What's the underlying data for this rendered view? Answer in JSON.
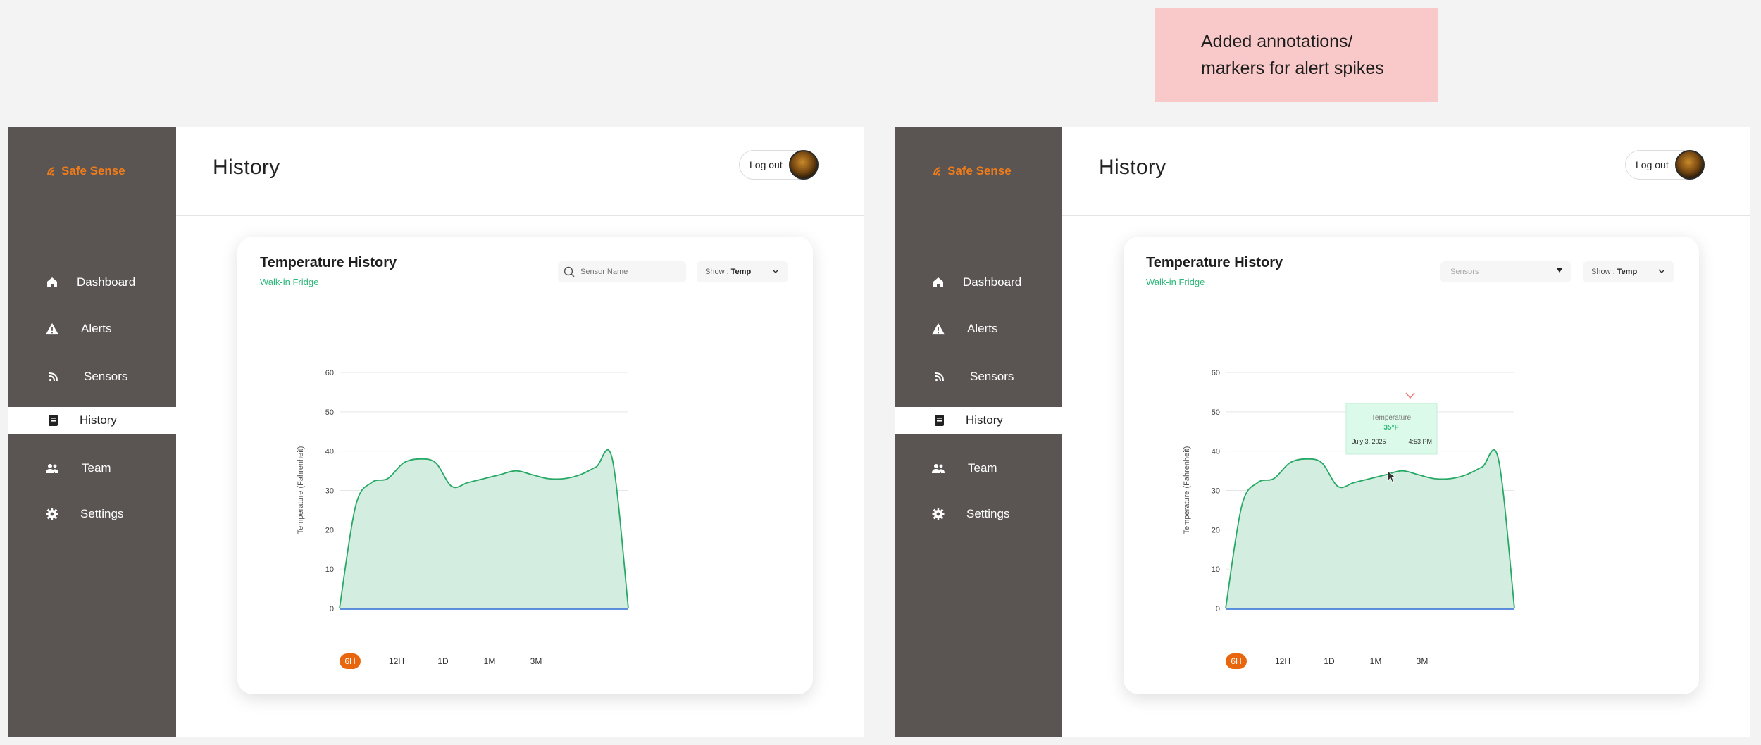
{
  "app": {
    "brand": "Safe Sense"
  },
  "colors": {
    "brand": "#f07c1a",
    "sidebar": "#5a5553",
    "accent_green": "#2fb67a",
    "area_fill": "#d3eee0",
    "area_line": "#28a866",
    "active_range": "#e8670e"
  },
  "nav": [
    {
      "label": "Dashboard",
      "icon": "home-icon"
    },
    {
      "label": "Alerts",
      "icon": "warning-icon"
    },
    {
      "label": "Sensors",
      "icon": "signal-icon"
    },
    {
      "label": "History",
      "icon": "history-icon",
      "active": true
    },
    {
      "label": "Team",
      "icon": "team-icon"
    },
    {
      "label": "Settings",
      "icon": "gear-icon"
    }
  ],
  "header": {
    "title": "History",
    "logout_label": "Log out"
  },
  "card": {
    "title": "Temperature History",
    "subtitle": "Walk-in Fridge",
    "search_placeholder": "Sensor Name",
    "sensors_placeholder": "Sensors",
    "show_label": "Show :",
    "show_value": "Temp",
    "ranges": [
      "6H",
      "12H",
      "1D",
      "1M",
      "3M"
    ],
    "active_range": "6H"
  },
  "tooltip": {
    "title": "Temperature",
    "value": "35°F",
    "date": "July 3, 2025",
    "time": "4:53 PM"
  },
  "annotation": {
    "line1": "Added annotations/",
    "line2": "markers for alert spikes"
  },
  "chart_data": {
    "type": "area",
    "title": "",
    "xlabel": "",
    "ylabel": "Temperature (Fahrenheit)",
    "ylim": [
      0,
      60
    ],
    "yticks": [
      "0",
      "10",
      "20",
      "30",
      "40",
      "50",
      "60"
    ],
    "grid": true,
    "series": [
      {
        "values": [
          0,
          26,
          32,
          33,
          37,
          38,
          37,
          31,
          32,
          33,
          34,
          35,
          34,
          33,
          33,
          34,
          36,
          38,
          0
        ]
      }
    ]
  }
}
